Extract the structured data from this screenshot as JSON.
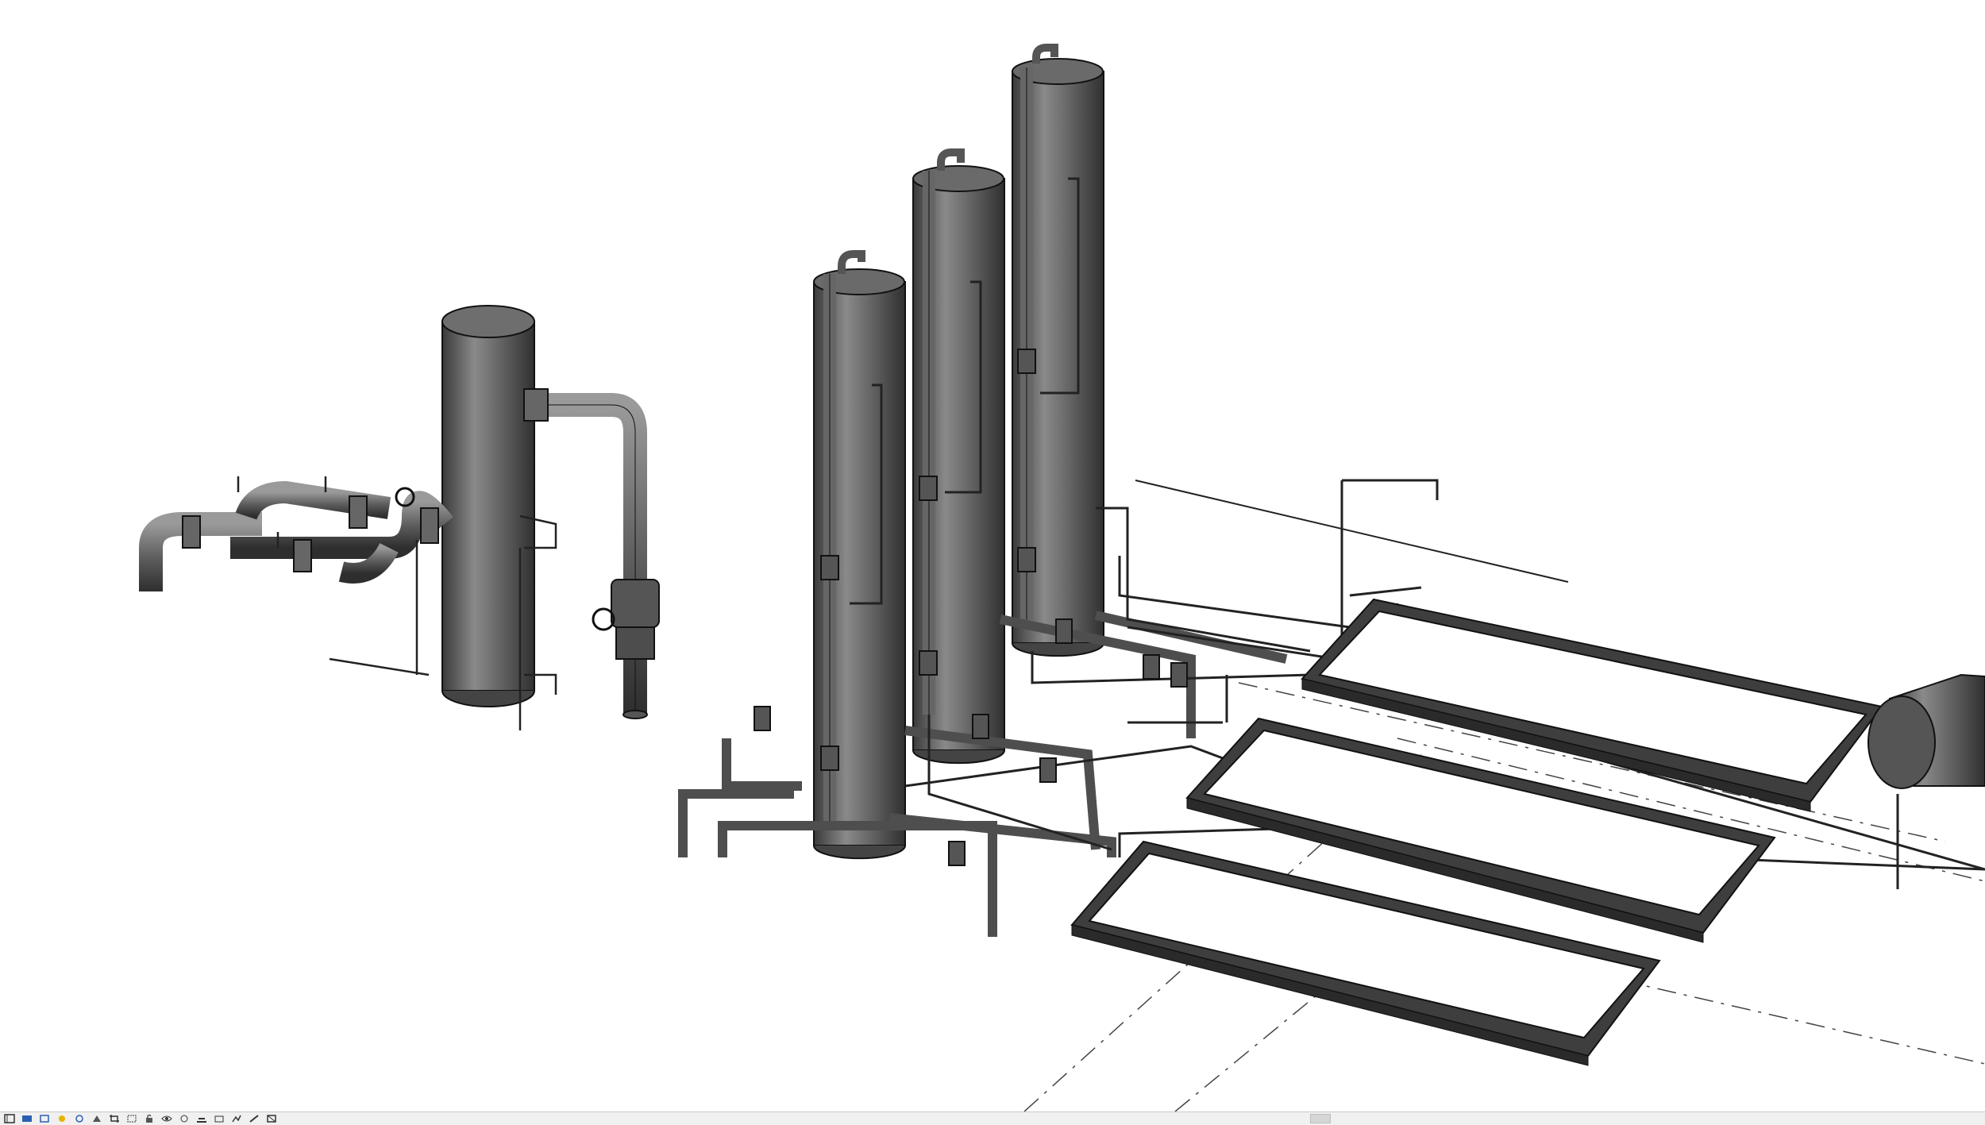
{
  "app": {
    "view_type": "3D view",
    "render_style": "shaded",
    "background_color": "#ffffff",
    "equipment_color": "#5c5c5c",
    "edge_color": "#111111"
  },
  "scene": {
    "equipment": [
      "left-vessel",
      "column-1",
      "column-2",
      "column-3",
      "horizontal-drum",
      "basin-1",
      "basin-2",
      "basin-3"
    ]
  },
  "view_control_bar": {
    "icons": [
      "scale-icon",
      "detail-level-icon",
      "visual-style-icon",
      "sun-path-icon",
      "shadows-icon",
      "render-icon",
      "crop-view-icon",
      "show-crop-icon",
      "unlock-3d-icon",
      "temporary-hide-icon",
      "reveal-hidden-icon",
      "worksharing-icon",
      "design-options-icon",
      "analytical-icon",
      "highlight-icon",
      "constraints-icon"
    ]
  }
}
